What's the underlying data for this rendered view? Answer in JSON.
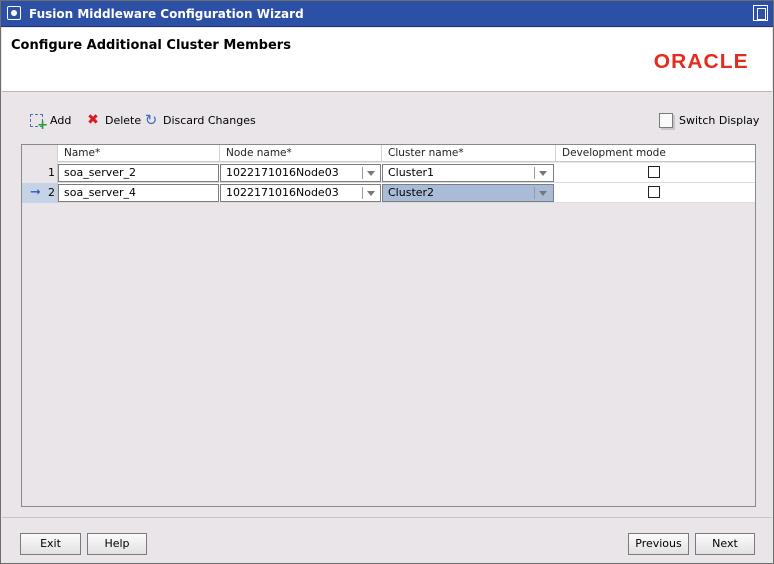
{
  "window": {
    "title": "Fusion Middleware Configuration Wizard"
  },
  "header": {
    "title": "Configure Additional Cluster Members",
    "logo": "ORACLE"
  },
  "toolbar": {
    "add_label": "Add",
    "delete_label": "Delete",
    "discard_label": "Discard Changes",
    "switch_label": "Switch Display"
  },
  "table": {
    "columns": [
      "Name*",
      "Node name*",
      "Cluster name*",
      "Development mode"
    ],
    "rows": [
      {
        "num": "1",
        "name": "soa_server_2",
        "node": "1022171016Node03",
        "cluster": "Cluster1",
        "dev_mode": false,
        "selected": false
      },
      {
        "num": "2",
        "name": "soa_server_4",
        "node": "1022171016Node03",
        "cluster": "Cluster2",
        "dev_mode": false,
        "selected": true
      }
    ]
  },
  "buttons": {
    "exit": "Exit",
    "help": "Help",
    "previous": "Previous",
    "next": "Next"
  },
  "colors": {
    "titlebar": "#2d50a7",
    "oracle_red": "#e32b1e",
    "selected_cell": "#a9bcd7",
    "window_bg": "#e9e5e8"
  },
  "icons": {
    "window": "circle-window-icon",
    "add": "add-row-icon",
    "delete": "red-x-icon",
    "discard": "undo-arrow-icon",
    "switch": "document-icon",
    "row_pointer": "right-arrow-icon"
  }
}
